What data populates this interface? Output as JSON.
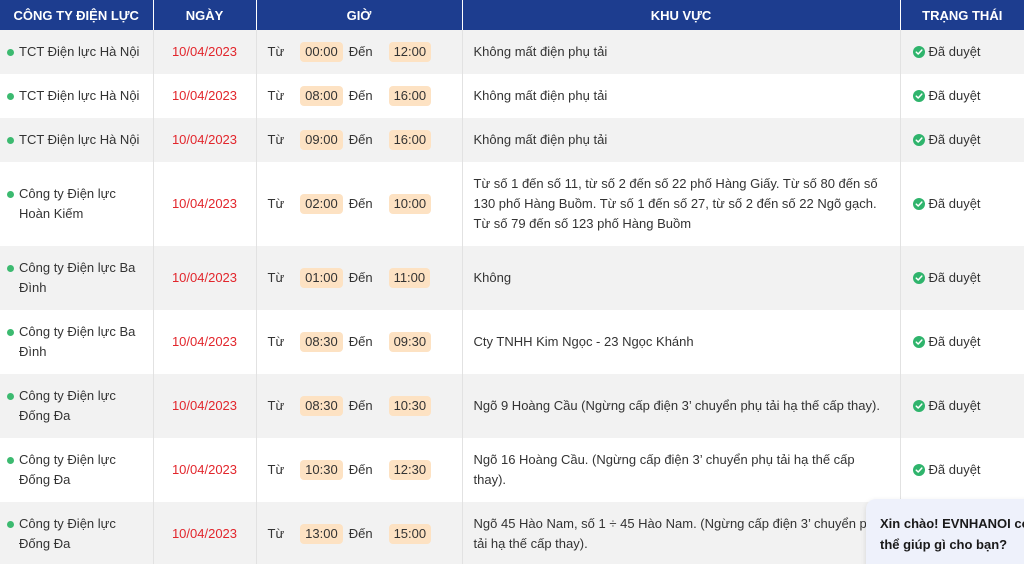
{
  "columns": {
    "company": "CÔNG TY ĐIỆN LỰC",
    "date": "NGÀY",
    "time": "GIỜ",
    "area": "KHU VỰC",
    "status": "TRẠNG THÁI"
  },
  "labels": {
    "from": "Từ",
    "to": "Đến"
  },
  "colors": {
    "header_bg": "#1d3d8f",
    "date": "#e2262c",
    "time_pill": "#fde2c3",
    "status_ok": "#2fb46c",
    "dot": "#3cba70"
  },
  "rows": [
    {
      "company": "TCT Điện lực Hà Nội",
      "date": "10/04/2023",
      "start": "00:00",
      "end": "12:00",
      "area": "Không mất điện phụ tải",
      "status": "Đã duyệt"
    },
    {
      "company": "TCT Điện lực Hà Nội",
      "date": "10/04/2023",
      "start": "08:00",
      "end": "16:00",
      "area": "Không mất điện phụ tải",
      "status": "Đã duyệt"
    },
    {
      "company": "TCT Điện lực Hà Nội",
      "date": "10/04/2023",
      "start": "09:00",
      "end": "16:00",
      "area": "Không mất điện phụ tải",
      "status": "Đã duyệt"
    },
    {
      "company": "Công ty Điện lực Hoàn Kiếm",
      "date": "10/04/2023",
      "start": "02:00",
      "end": "10:00",
      "area": "Từ số 1 đến số 11, từ số 2 đến số 22 phố Hàng Giấy. Từ số 80 đến số 130 phố Hàng Buồm. Từ số 1 đến số 27, từ số 2 đến số 22 Ngõ gạch. Từ số 79 đến số 123 phố Hàng Buồm",
      "status": "Đã duyệt"
    },
    {
      "company": "Công ty Điện lực Ba Đình",
      "date": "10/04/2023",
      "start": "01:00",
      "end": "11:00",
      "area": "Không",
      "status": "Đã duyệt"
    },
    {
      "company": "Công ty Điện lực Ba Đình",
      "date": "10/04/2023",
      "start": "08:30",
      "end": "09:30",
      "area": "Cty TNHH Kim Ngọc - 23 Ngọc Khánh",
      "status": "Đã duyệt"
    },
    {
      "company": "Công ty Điện lực Đống Đa",
      "date": "10/04/2023",
      "start": "08:30",
      "end": "10:30",
      "area": "Ngõ 9 Hoàng Cầu (Ngừng cấp điện 3’ chuyển phụ tải hạ thế cấp thay).",
      "status": "Đã duyệt"
    },
    {
      "company": "Công ty Điện lực Đống Đa",
      "date": "10/04/2023",
      "start": "10:30",
      "end": "12:30",
      "area": "Ngõ 16 Hoàng Cầu. (Ngừng cấp điện 3’ chuyển phụ tải hạ thế cấp thay).",
      "status": "Đã duyệt"
    },
    {
      "company": "Công ty Điện lực Đống Đa",
      "date": "10/04/2023",
      "start": "13:00",
      "end": "15:00",
      "area": "Ngõ 45 Hào Nam, số 1 ÷ 45 Hào Nam. (Ngừng cấp điện 3’ chuyển phụ tải hạ thế cấp thay).",
      "status": ""
    }
  ],
  "chat": {
    "line1": "Xin chào! EVNHANOI có",
    "line2": "thể giúp gì cho bạn?"
  }
}
